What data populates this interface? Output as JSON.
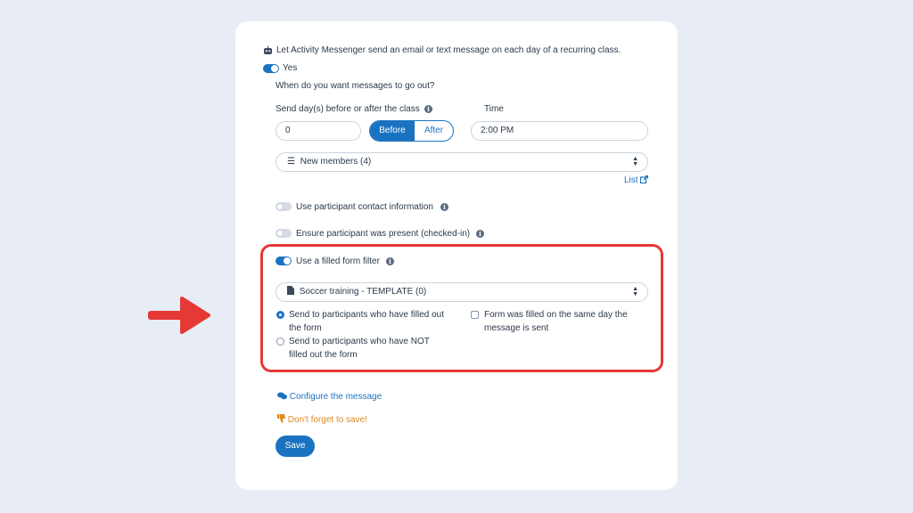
{
  "intro": {
    "robot_icon": "robot-icon",
    "text": "Let Activity Messenger send an email or text message on each day of a recurring class.",
    "toggle_label": "Yes",
    "toggle_on": true
  },
  "schedule": {
    "question": "When do you want messages to go out?",
    "days_label": "Send day(s) before or after the class",
    "days_value": "0",
    "before_label": "Before",
    "after_label": "After",
    "selected": "Before",
    "time_label": "Time",
    "time_value": "2:00 PM"
  },
  "list_select": {
    "icon": "list-icon",
    "value": "New members (4)",
    "link_label": "List",
    "link_icon": "external-link-icon"
  },
  "options": {
    "contact_info_label": "Use participant contact information",
    "contact_info_on": false,
    "present_label": "Ensure participant was present (checked-in)",
    "present_on": false,
    "form_filter_label": "Use a filled form filter",
    "form_filter_on": true
  },
  "form_filter": {
    "form_icon": "document-icon",
    "form_value": "Soccer training - TEMPLATE (0)",
    "radio_filled_line1": "Send to participants who have filled out",
    "radio_filled_line2": "the form",
    "radio_filled_checked": true,
    "radio_not_filled_line1": "Send to participants who have NOT",
    "radio_not_filled_line2": "filled out the form",
    "radio_not_filled_checked": false,
    "same_day_line1": "Form was filled on the same day the",
    "same_day_line2": "message is sent",
    "same_day_checked": false
  },
  "footer": {
    "configure_icon": "comments-icon",
    "configure_label": "Configure the message",
    "warning_icon": "thumbs-down-icon",
    "warning_label": "Don't forget to save!",
    "save_label": "Save"
  },
  "colors": {
    "accent": "#1a73c1",
    "highlight": "#e53935",
    "warning": "#e08a1e",
    "background": "#e8edf5"
  }
}
